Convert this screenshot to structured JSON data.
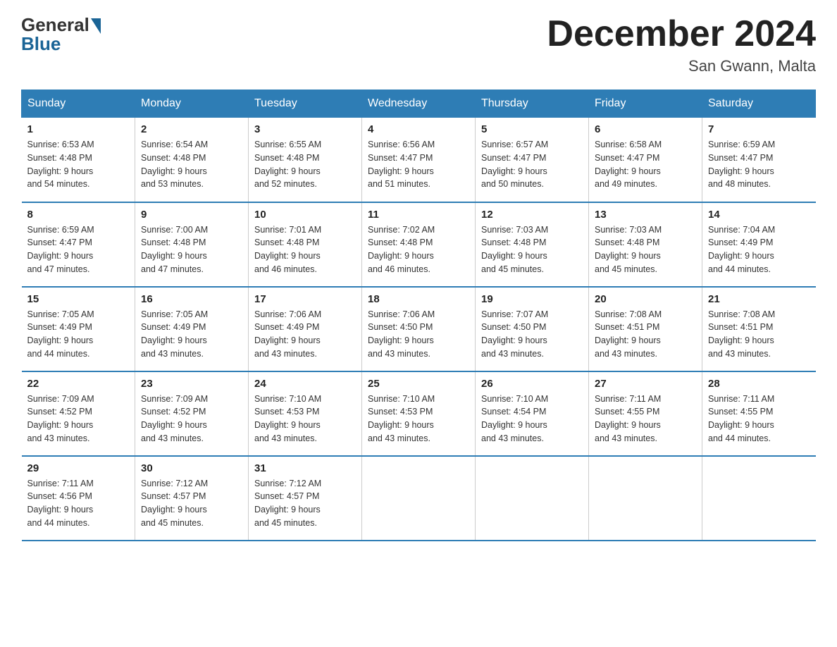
{
  "logo": {
    "general": "General",
    "blue": "Blue"
  },
  "title": "December 2024",
  "location": "San Gwann, Malta",
  "days_of_week": [
    "Sunday",
    "Monday",
    "Tuesday",
    "Wednesday",
    "Thursday",
    "Friday",
    "Saturday"
  ],
  "weeks": [
    [
      {
        "day": "1",
        "sunrise": "6:53 AM",
        "sunset": "4:48 PM",
        "daylight": "9 hours and 54 minutes."
      },
      {
        "day": "2",
        "sunrise": "6:54 AM",
        "sunset": "4:48 PM",
        "daylight": "9 hours and 53 minutes."
      },
      {
        "day": "3",
        "sunrise": "6:55 AM",
        "sunset": "4:48 PM",
        "daylight": "9 hours and 52 minutes."
      },
      {
        "day": "4",
        "sunrise": "6:56 AM",
        "sunset": "4:47 PM",
        "daylight": "9 hours and 51 minutes."
      },
      {
        "day": "5",
        "sunrise": "6:57 AM",
        "sunset": "4:47 PM",
        "daylight": "9 hours and 50 minutes."
      },
      {
        "day": "6",
        "sunrise": "6:58 AM",
        "sunset": "4:47 PM",
        "daylight": "9 hours and 49 minutes."
      },
      {
        "day": "7",
        "sunrise": "6:59 AM",
        "sunset": "4:47 PM",
        "daylight": "9 hours and 48 minutes."
      }
    ],
    [
      {
        "day": "8",
        "sunrise": "6:59 AM",
        "sunset": "4:47 PM",
        "daylight": "9 hours and 47 minutes."
      },
      {
        "day": "9",
        "sunrise": "7:00 AM",
        "sunset": "4:48 PM",
        "daylight": "9 hours and 47 minutes."
      },
      {
        "day": "10",
        "sunrise": "7:01 AM",
        "sunset": "4:48 PM",
        "daylight": "9 hours and 46 minutes."
      },
      {
        "day": "11",
        "sunrise": "7:02 AM",
        "sunset": "4:48 PM",
        "daylight": "9 hours and 46 minutes."
      },
      {
        "day": "12",
        "sunrise": "7:03 AM",
        "sunset": "4:48 PM",
        "daylight": "9 hours and 45 minutes."
      },
      {
        "day": "13",
        "sunrise": "7:03 AM",
        "sunset": "4:48 PM",
        "daylight": "9 hours and 45 minutes."
      },
      {
        "day": "14",
        "sunrise": "7:04 AM",
        "sunset": "4:49 PM",
        "daylight": "9 hours and 44 minutes."
      }
    ],
    [
      {
        "day": "15",
        "sunrise": "7:05 AM",
        "sunset": "4:49 PM",
        "daylight": "9 hours and 44 minutes."
      },
      {
        "day": "16",
        "sunrise": "7:05 AM",
        "sunset": "4:49 PM",
        "daylight": "9 hours and 43 minutes."
      },
      {
        "day": "17",
        "sunrise": "7:06 AM",
        "sunset": "4:49 PM",
        "daylight": "9 hours and 43 minutes."
      },
      {
        "day": "18",
        "sunrise": "7:06 AM",
        "sunset": "4:50 PM",
        "daylight": "9 hours and 43 minutes."
      },
      {
        "day": "19",
        "sunrise": "7:07 AM",
        "sunset": "4:50 PM",
        "daylight": "9 hours and 43 minutes."
      },
      {
        "day": "20",
        "sunrise": "7:08 AM",
        "sunset": "4:51 PM",
        "daylight": "9 hours and 43 minutes."
      },
      {
        "day": "21",
        "sunrise": "7:08 AM",
        "sunset": "4:51 PM",
        "daylight": "9 hours and 43 minutes."
      }
    ],
    [
      {
        "day": "22",
        "sunrise": "7:09 AM",
        "sunset": "4:52 PM",
        "daylight": "9 hours and 43 minutes."
      },
      {
        "day": "23",
        "sunrise": "7:09 AM",
        "sunset": "4:52 PM",
        "daylight": "9 hours and 43 minutes."
      },
      {
        "day": "24",
        "sunrise": "7:10 AM",
        "sunset": "4:53 PM",
        "daylight": "9 hours and 43 minutes."
      },
      {
        "day": "25",
        "sunrise": "7:10 AM",
        "sunset": "4:53 PM",
        "daylight": "9 hours and 43 minutes."
      },
      {
        "day": "26",
        "sunrise": "7:10 AM",
        "sunset": "4:54 PM",
        "daylight": "9 hours and 43 minutes."
      },
      {
        "day": "27",
        "sunrise": "7:11 AM",
        "sunset": "4:55 PM",
        "daylight": "9 hours and 43 minutes."
      },
      {
        "day": "28",
        "sunrise": "7:11 AM",
        "sunset": "4:55 PM",
        "daylight": "9 hours and 44 minutes."
      }
    ],
    [
      {
        "day": "29",
        "sunrise": "7:11 AM",
        "sunset": "4:56 PM",
        "daylight": "9 hours and 44 minutes."
      },
      {
        "day": "30",
        "sunrise": "7:12 AM",
        "sunset": "4:57 PM",
        "daylight": "9 hours and 45 minutes."
      },
      {
        "day": "31",
        "sunrise": "7:12 AM",
        "sunset": "4:57 PM",
        "daylight": "9 hours and 45 minutes."
      },
      null,
      null,
      null,
      null
    ]
  ],
  "labels": {
    "sunrise": "Sunrise:",
    "sunset": "Sunset:",
    "daylight": "Daylight:"
  }
}
